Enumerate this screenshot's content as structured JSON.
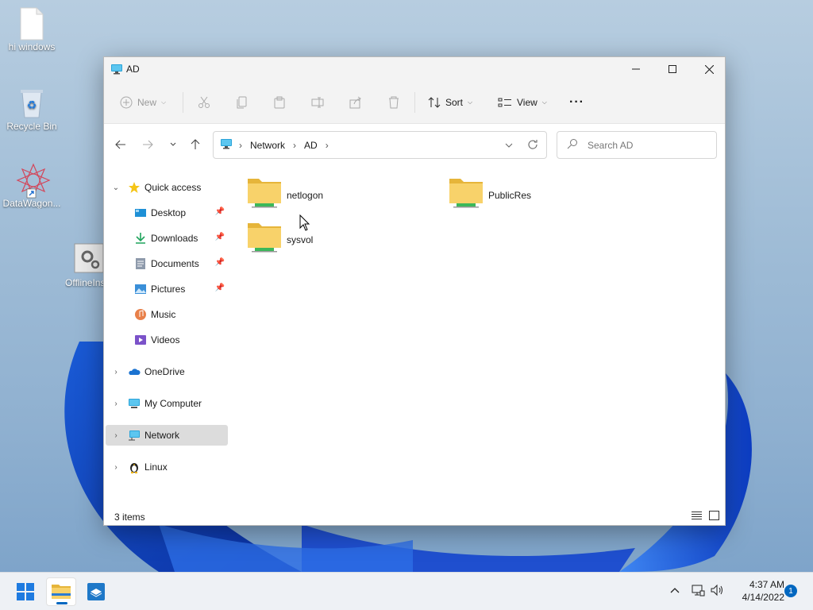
{
  "desktop": {
    "icons": [
      {
        "label": "hi windows",
        "icon": "text-file-icon"
      },
      {
        "label": "Recycle Bin",
        "icon": "recycle-bin-icon"
      },
      {
        "label": "DataWagon...",
        "icon": "datawagon-shortcut-icon"
      },
      {
        "label": "OfflineIns",
        "icon": "settings-app-icon"
      }
    ]
  },
  "window": {
    "title": "AD",
    "controls": {
      "minimize": "minimize",
      "maximize": "maximize",
      "close": "close"
    }
  },
  "toolbar": {
    "new_label": "New",
    "sort_label": "Sort",
    "view_label": "View",
    "more_label": "···"
  },
  "address": {
    "breadcrumb": [
      "Network",
      "AD"
    ],
    "search_placeholder": "Search AD"
  },
  "sidebar": {
    "items": [
      {
        "label": "Quick access",
        "icon": "star-icon"
      },
      {
        "label": "Desktop",
        "icon": "desktop-icon",
        "pinned": true
      },
      {
        "label": "Downloads",
        "icon": "download-icon",
        "pinned": true
      },
      {
        "label": "Documents",
        "icon": "documents-icon",
        "pinned": true
      },
      {
        "label": "Pictures",
        "icon": "pictures-icon",
        "pinned": true
      },
      {
        "label": "Music",
        "icon": "music-icon"
      },
      {
        "label": "Videos",
        "icon": "videos-icon"
      },
      {
        "label": "OneDrive",
        "icon": "cloud-icon"
      },
      {
        "label": "My Computer",
        "icon": "computer-icon"
      },
      {
        "label": "Network",
        "icon": "network-icon",
        "selected": true
      },
      {
        "label": "Linux",
        "icon": "linux-penguin-icon"
      }
    ]
  },
  "content": {
    "folders": [
      {
        "name": "netlogon"
      },
      {
        "name": "PublicRes"
      },
      {
        "name": "sysvol"
      }
    ]
  },
  "status": {
    "item_count": "3 items"
  },
  "taskbar": {
    "time": "4:37 AM",
    "date": "4/14/2022",
    "notification_count": "1"
  },
  "colors": {
    "accent": "#0067c0",
    "folder_yellow": "#f8c94a",
    "selected_bg": "#dcdcdc"
  }
}
